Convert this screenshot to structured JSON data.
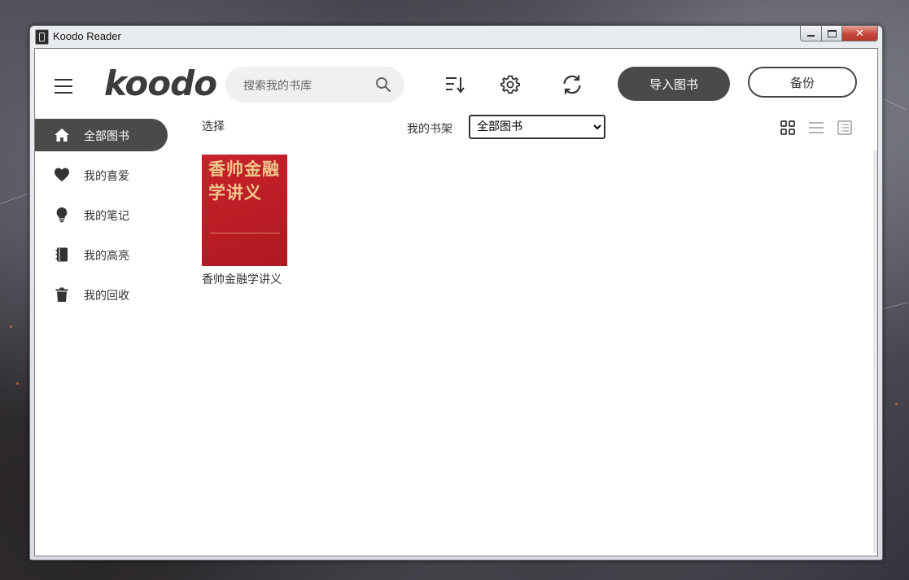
{
  "window": {
    "title": "Koodo Reader"
  },
  "header": {
    "logo_text": "koodo",
    "search_placeholder": "搜索我的书库",
    "import_label": "导入图书",
    "backup_label": "备份"
  },
  "sidebar": {
    "items": [
      {
        "label": "全部图书",
        "icon": "home-icon",
        "active": true
      },
      {
        "label": "我的喜爱",
        "icon": "heart-icon",
        "active": false
      },
      {
        "label": "我的笔记",
        "icon": "lightbulb-icon",
        "active": false
      },
      {
        "label": "我的高亮",
        "icon": "notebook-icon",
        "active": false
      },
      {
        "label": "我的回收",
        "icon": "trash-icon",
        "active": false
      }
    ]
  },
  "toolbar": {
    "select_label": "选择",
    "shelf_label": "我的书架",
    "shelf_selected": "全部图书"
  },
  "books": [
    {
      "title": "香帅金融学讲义",
      "cover_title": "香帅金融学讲义"
    }
  ],
  "colors": {
    "accent": "#4a4a4a",
    "cover": "#c8232c",
    "cover_text": "#f2c78a"
  }
}
